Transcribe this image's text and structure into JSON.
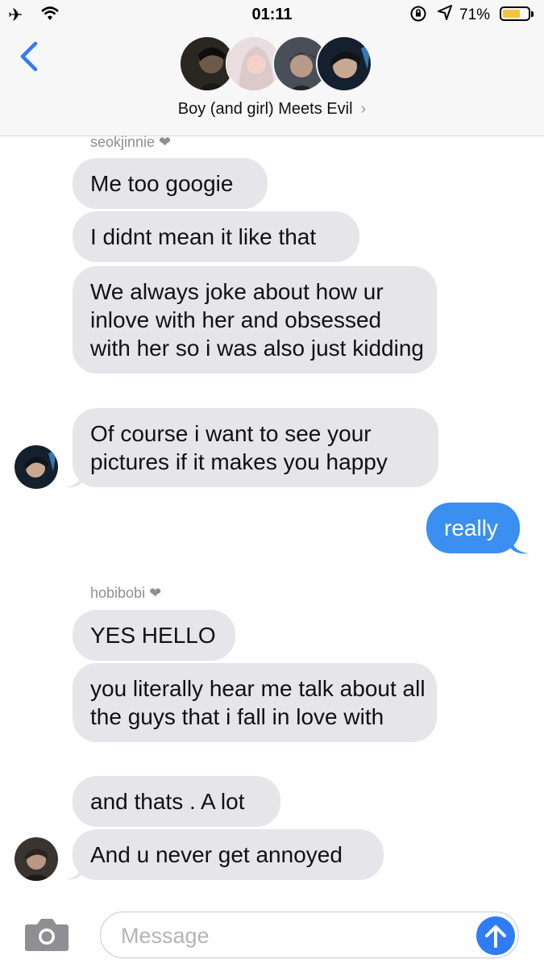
{
  "status_bar": {
    "time": "01:11",
    "battery_percent": "71%",
    "battery_level": 0.71
  },
  "header": {
    "group_name": "Boy (and girl) Meets Evil",
    "chevron": "›"
  },
  "messages": [
    {
      "sender": "seokjinnie ❤"
    },
    {
      "text": "Me too googie"
    },
    {
      "text": "I didnt mean it like that"
    },
    {
      "text": "We always joke about how ur inlove with her and obsessed with her so i was also just kidding"
    },
    {
      "text": "Of course i want to see your pictures if it makes you happy"
    },
    {
      "text": "really"
    },
    {
      "sender": "hobibobi ❤"
    },
    {
      "text": "YES HELLO"
    },
    {
      "text": "you literally hear me talk about all the guys that i fall in love with"
    },
    {
      "text": "and thats . A lot"
    },
    {
      "text": "And u never get annoyed"
    }
  ],
  "input": {
    "placeholder": "Message"
  },
  "colors": {
    "incoming_bubble": "#e5e5ea",
    "outgoing_bubble": "#3a8ff0",
    "accent": "#2f7cf6",
    "battery": "#f5c33b"
  },
  "icons": [
    "airplane-icon",
    "wifi-icon",
    "rotation-lock-icon",
    "location-icon",
    "battery-icon",
    "back-chevron-icon",
    "camera-icon",
    "send-arrow-icon"
  ]
}
